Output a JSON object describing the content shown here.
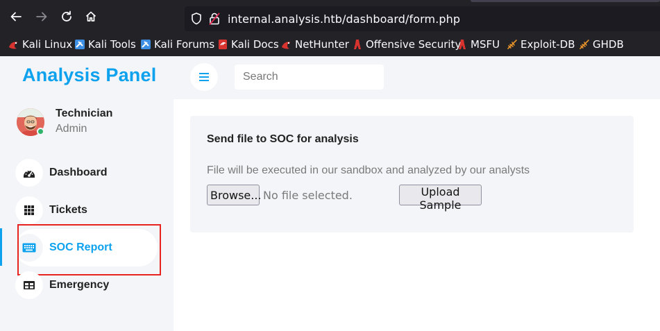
{
  "browser": {
    "url": "internal.analysis.htb/dashboard/form.php",
    "bookmarks": [
      {
        "label": "Kali Linux",
        "icon": "kali-dragon-icon"
      },
      {
        "label": "Kali Tools",
        "icon": "kali-tools-icon"
      },
      {
        "label": "Kali Forums",
        "icon": "kali-forums-icon"
      },
      {
        "label": "Kali Docs",
        "icon": "kali-docs-icon"
      },
      {
        "label": "NetHunter",
        "icon": "nethunter-icon"
      },
      {
        "label": "Offensive Security",
        "icon": "offsec-icon"
      },
      {
        "label": "MSFU",
        "icon": "msfu-icon"
      },
      {
        "label": "Exploit-DB",
        "icon": "exploitdb-icon"
      },
      {
        "label": "GHDB",
        "icon": "ghdb-icon"
      }
    ]
  },
  "sidebar": {
    "brand": "Analysis Panel",
    "user": {
      "name": "Technician",
      "role": "Admin"
    },
    "items": [
      {
        "label": "Dashboard",
        "icon": "gauge-icon"
      },
      {
        "label": "Tickets",
        "icon": "grid-icon"
      },
      {
        "label": "SOC Report",
        "icon": "keyboard-icon",
        "active": true
      },
      {
        "label": "Emergency",
        "icon": "table-icon"
      }
    ]
  },
  "topbar": {
    "search_placeholder": "Search"
  },
  "form": {
    "title": "Send file to SOC for analysis",
    "description": "File will be executed in our sandbox and analyzed by our analysts",
    "browse_label": "Browse...",
    "no_file_text": "No file selected.",
    "upload_label": "Upload Sample"
  },
  "colors": {
    "accent": "#0ea2ee",
    "highlight": "#e8231f",
    "online": "#2fb36b"
  }
}
